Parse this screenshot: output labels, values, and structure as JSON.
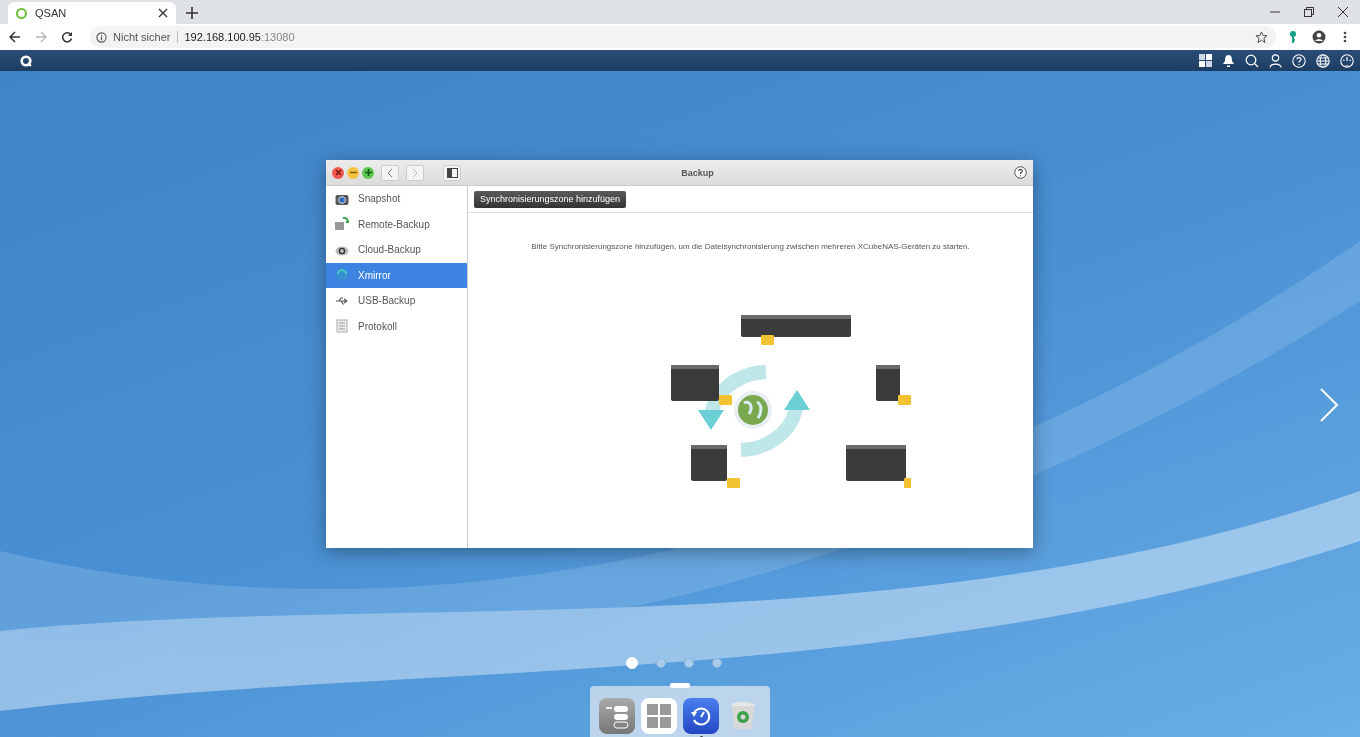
{
  "browser": {
    "tab": {
      "title": "QSAN"
    },
    "address": {
      "security": "Nicht sicher",
      "host": "192.168.100.95",
      "port": ":13080"
    }
  },
  "window": {
    "title": "Backup"
  },
  "sidebar": {
    "items": [
      {
        "label": "Snapshot",
        "kind": "snapshot",
        "selected": false
      },
      {
        "label": "Remote-Backup",
        "kind": "remote",
        "selected": false
      },
      {
        "label": "Cloud-Backup",
        "kind": "cloud",
        "selected": false
      },
      {
        "label": "Xmirror",
        "kind": "xmirror",
        "selected": true
      },
      {
        "label": "USB-Backup",
        "kind": "usb",
        "selected": false
      },
      {
        "label": "Protokoll",
        "kind": "log",
        "selected": false
      }
    ]
  },
  "toolbar": {
    "button": "Synchronisierungszone hinzufügen"
  },
  "message": "Bitte Synchronisierungszone hinzufügen, um die Dateisynchronisierung zwischen mehreren XCubeNAS-Geräten zu starten.",
  "page_dots": [
    {
      "selected": true
    },
    {
      "selected": false
    },
    {
      "selected": false
    },
    {
      "selected": false
    }
  ],
  "dock": [
    {
      "kind": "settings",
      "running": false
    },
    {
      "kind": "apps",
      "running": false
    },
    {
      "kind": "backup",
      "running": true
    },
    {
      "kind": "trash",
      "running": false
    }
  ]
}
